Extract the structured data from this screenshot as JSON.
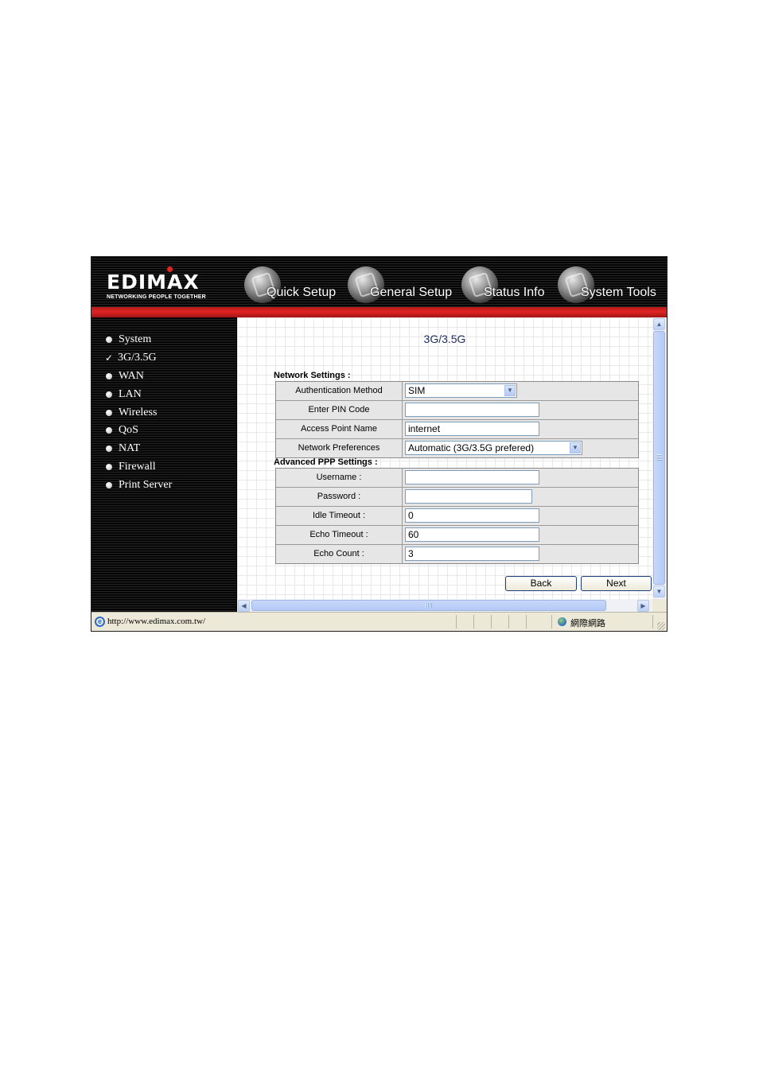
{
  "brand": {
    "name": "EDIMAX",
    "tagline": "NETWORKING PEOPLE TOGETHER"
  },
  "nav": {
    "tabs": [
      {
        "label": "Quick Setup",
        "icon": "quick-setup-icon"
      },
      {
        "label": "General Setup",
        "icon": "general-setup-icon"
      },
      {
        "label": "Status Info",
        "icon": "status-info-icon"
      },
      {
        "label": "System Tools",
        "icon": "system-tools-icon"
      }
    ]
  },
  "sidebar": {
    "items": [
      {
        "label": "System",
        "marker": "bullet"
      },
      {
        "label": "3G/3.5G",
        "marker": "check",
        "selected": true
      },
      {
        "label": "WAN",
        "marker": "bullet"
      },
      {
        "label": "LAN",
        "marker": "bullet"
      },
      {
        "label": "Wireless",
        "marker": "bullet"
      },
      {
        "label": "QoS",
        "marker": "bullet"
      },
      {
        "label": "NAT",
        "marker": "bullet"
      },
      {
        "label": "Firewall",
        "marker": "bullet"
      },
      {
        "label": "Print Server",
        "marker": "bullet"
      }
    ]
  },
  "main": {
    "title": "3G/3.5G",
    "network_settings": {
      "heading": "Network Settings :",
      "auth_method": {
        "label": "Authentication Method",
        "value": "SIM"
      },
      "pin_code": {
        "label": "Enter PIN Code",
        "value": ""
      },
      "apn": {
        "label": "Access Point Name",
        "value": "internet"
      },
      "preferences": {
        "label": "Network Preferences",
        "value": "Automatic (3G/3.5G prefered)"
      }
    },
    "ppp_settings": {
      "heading": "Advanced PPP Settings :",
      "username": {
        "label": "Username :",
        "value": ""
      },
      "password": {
        "label": "Password :",
        "value": ""
      },
      "idle_timeout": {
        "label": "Idle Timeout :",
        "value": "0"
      },
      "echo_timeout": {
        "label": "Echo Timeout :",
        "value": "60"
      },
      "echo_count": {
        "label": "Echo Count :",
        "value": "3"
      }
    },
    "buttons": {
      "back": "Back",
      "next": "Next"
    }
  },
  "statusbar": {
    "url": "http://www.edimax.com.tw/",
    "zone": "網際網路"
  },
  "colors": {
    "header_red": "#e02424",
    "title_blue": "#1b2b5a",
    "sidebar_bg": "#060606"
  }
}
